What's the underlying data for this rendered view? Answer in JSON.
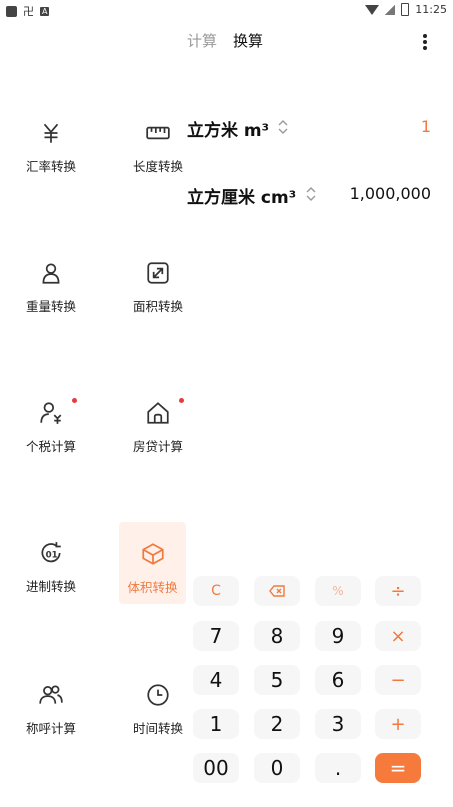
{
  "status": {
    "time": "11:25",
    "glyph_a": "卍",
    "glyph_b": "A"
  },
  "tabs": [
    {
      "label": "计算",
      "active": false
    },
    {
      "label": "换算",
      "active": true
    }
  ],
  "tools": [
    {
      "name": "exchange",
      "label": "汇率转换",
      "icon": "yen-icon"
    },
    {
      "name": "length",
      "label": "长度转换",
      "icon": "ruler-icon"
    },
    {
      "name": "weight",
      "label": "重量转换",
      "icon": "weight-icon"
    },
    {
      "name": "area",
      "label": "面积转换",
      "icon": "expand-icon"
    },
    {
      "name": "tax",
      "label": "个税计算",
      "icon": "person-yen-icon",
      "badge": true
    },
    {
      "name": "mortgage",
      "label": "房贷计算",
      "icon": "house-icon",
      "badge": true
    },
    {
      "name": "base",
      "label": "进制转换",
      "icon": "base-icon"
    },
    {
      "name": "volume",
      "label": "体积转换",
      "icon": "cube-icon",
      "active": true
    },
    {
      "name": "kinship",
      "label": "称呼计算",
      "icon": "people-icon"
    },
    {
      "name": "time",
      "label": "时间转换",
      "icon": "clock-icon"
    }
  ],
  "conversion": {
    "from": {
      "unit": "立方米 m³",
      "value": "1"
    },
    "to": {
      "unit": "立方厘米 cm³",
      "value": "1,000,000"
    }
  },
  "keypad": {
    "clear": "C",
    "percent": "%",
    "divide": "÷",
    "multiply": "×",
    "minus": "−",
    "plus": "+",
    "equals": "=",
    "digits": [
      "7",
      "8",
      "9",
      "4",
      "5",
      "6",
      "1",
      "2",
      "3",
      "00",
      "0",
      "."
    ]
  },
  "colors": {
    "accent": "#f07a3f",
    "badge": "#e53b3b"
  }
}
